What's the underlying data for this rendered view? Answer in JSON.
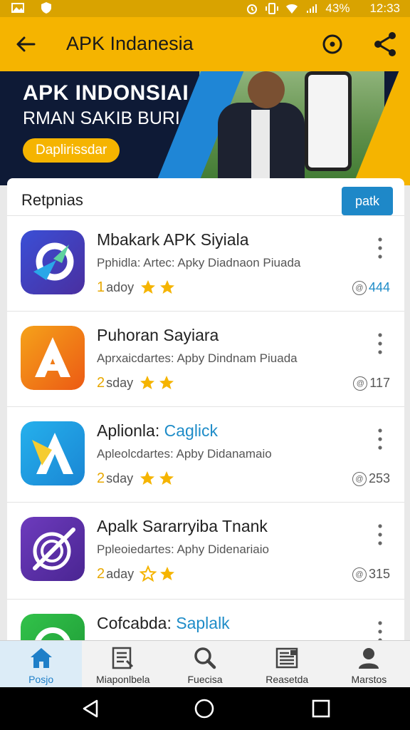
{
  "status_bar": {
    "battery": "43%",
    "time": "12:33"
  },
  "app_bar": {
    "title": "APK Indanesia"
  },
  "banner": {
    "title": "APK INDONSIAI",
    "subtitle": "RMAN SAKIB BURI",
    "button_label": "Daplirissdar"
  },
  "section": {
    "title": "Retpnias",
    "button_label": "patk"
  },
  "apps": [
    {
      "name": "Mbakark APK Siyiala",
      "name_accent": "",
      "desc": "Pphidla: Artec: Apky Diadnaon Piuada",
      "days_num": "1",
      "days_label": "adoy",
      "count": "444",
      "icon_colors": [
        "#3a4fd6",
        "#4a2fa0"
      ],
      "stars": [
        1,
        1
      ]
    },
    {
      "name": "Puhoran Sayiara",
      "name_accent": "",
      "desc": "Aprxaicdartes: Apby Dindnam Piuada",
      "days_num": "2",
      "days_label": "sday",
      "count": "117",
      "icon_colors": [
        "#f5a21a",
        "#ec5a14"
      ],
      "stars": [
        1,
        1
      ]
    },
    {
      "name": "Aplionla: ",
      "name_accent": "Caglick",
      "desc": "Apleolcdartes: Apby Didanamaio",
      "days_num": "2",
      "days_label": "sday",
      "count": "253",
      "icon_colors": [
        "#25b0ec",
        "#1a86d4"
      ],
      "stars": [
        1,
        1
      ]
    },
    {
      "name": "Apalk Sararryiba Tnank",
      "name_accent": "",
      "desc": "Ppleoiedartes: Aphy Didenariaio",
      "days_num": "2",
      "days_label": "aday",
      "count": "315",
      "icon_colors": [
        "#6d3bbd",
        "#4a2592"
      ],
      "stars": [
        0,
        1
      ]
    },
    {
      "name": "Cofcabda: ",
      "name_accent": "Saplalk",
      "desc": "",
      "days_num": "",
      "days_label": "",
      "count": "",
      "icon_colors": [
        "#32c24a",
        "#1e9a36"
      ],
      "stars": []
    }
  ],
  "bottom_nav": [
    {
      "label": "Posjo",
      "icon": "home-icon",
      "active": true
    },
    {
      "label": "Miaponlbela",
      "icon": "list-icon",
      "active": false
    },
    {
      "label": "Fuecisa",
      "icon": "search-icon",
      "active": false
    },
    {
      "label": "Reasetda",
      "icon": "news-icon",
      "active": false
    },
    {
      "label": "Marstos",
      "icon": "profile-icon",
      "active": false
    }
  ],
  "colors": {
    "accent_yellow": "#f5b400",
    "accent_blue": "#1e88c8",
    "star": "#f5b400"
  }
}
